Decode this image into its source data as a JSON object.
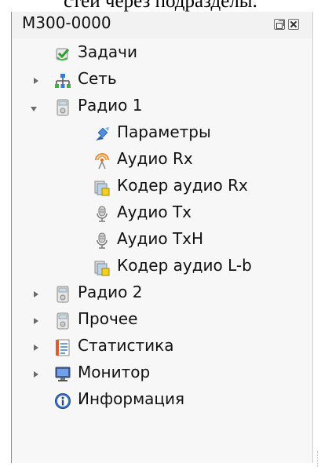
{
  "page_top_text": "стей через подразделы.",
  "panel": {
    "title": "M300-0000",
    "float_button_icon": "float-window-icon",
    "close_button_icon": "close-icon"
  },
  "tree": {
    "items": [
      {
        "label": "Задачи",
        "icon": "tasks-icon",
        "expander": "none"
      },
      {
        "label": "Сеть",
        "icon": "network-icon",
        "expander": "collapsed"
      },
      {
        "label": "Радио 1",
        "icon": "radio-device-icon",
        "expander": "expanded"
      },
      {
        "label": "Параметры",
        "icon": "parameters-icon",
        "expander": "none"
      },
      {
        "label": "Аудио Rx",
        "icon": "audio-rx-icon",
        "expander": "none"
      },
      {
        "label": "Кодер аудио Rx",
        "icon": "audio-encoder-icon",
        "expander": "none"
      },
      {
        "label": "Аудио Tx",
        "icon": "microphone-icon",
        "expander": "none"
      },
      {
        "label": "Аудио TxH",
        "icon": "microphone-icon",
        "expander": "none"
      },
      {
        "label": "Кодер аудио L-b",
        "icon": "audio-encoder-icon",
        "expander": "none"
      },
      {
        "label": "Радио 2",
        "icon": "radio-device-icon",
        "expander": "collapsed"
      },
      {
        "label": "Прочее",
        "icon": "radio-device-icon",
        "expander": "collapsed"
      },
      {
        "label": "Статистика",
        "icon": "statistics-icon",
        "expander": "collapsed"
      },
      {
        "label": "Монитор",
        "icon": "monitor-icon",
        "expander": "collapsed"
      },
      {
        "label": "Информация",
        "icon": "info-icon",
        "expander": "none"
      }
    ]
  }
}
